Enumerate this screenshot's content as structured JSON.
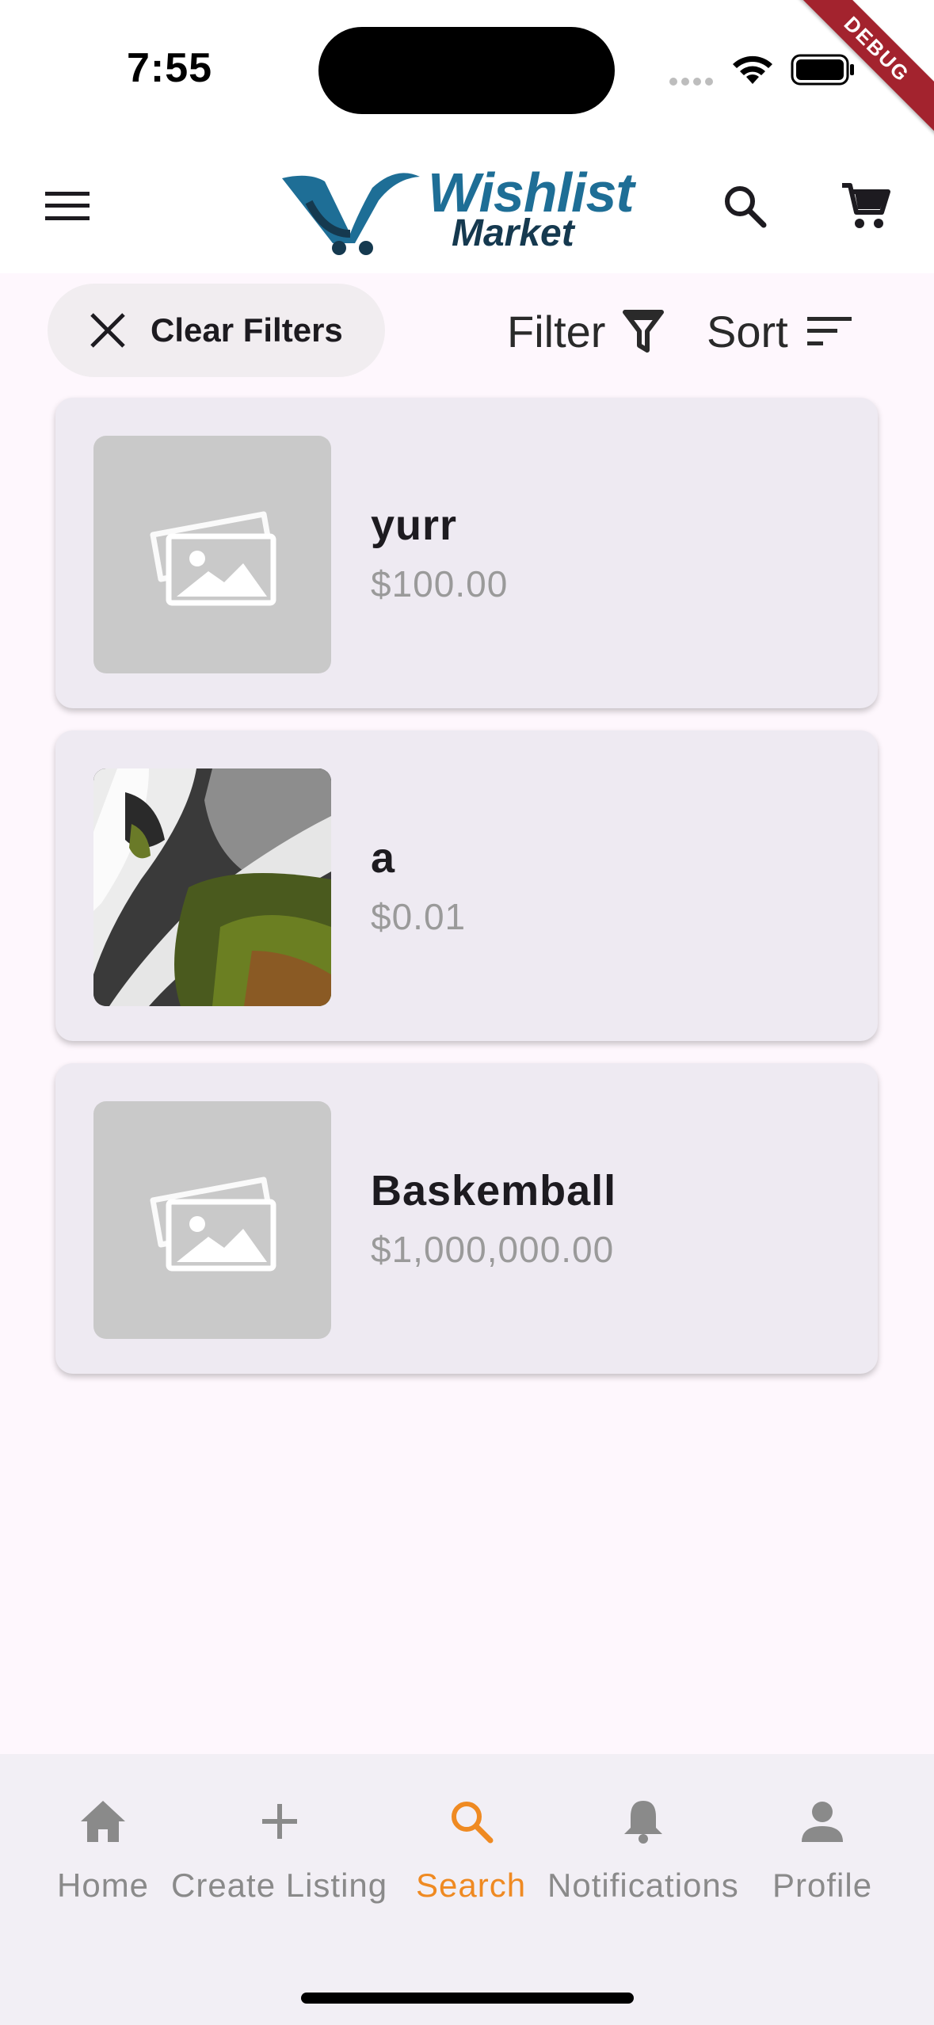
{
  "status_bar": {
    "time": "7:55"
  },
  "debug_label": "DEBUG",
  "app_bar": {
    "logo_title": "Wishlist",
    "logo_subtitle": "Market",
    "menu_icon": "hamburger-menu-icon",
    "search_icon": "search-icon",
    "cart_icon": "shopping-cart-icon"
  },
  "filters": {
    "clear_label": "Clear Filters",
    "filter_label": "Filter",
    "sort_label": "Sort"
  },
  "listings": [
    {
      "title": "yurr",
      "price": "$100.00",
      "image": "placeholder-image-icon"
    },
    {
      "title": "a",
      "price": "$0.01",
      "image": "waterfall-photo"
    },
    {
      "title": "Baskemball",
      "price": "$1,000,000.00",
      "image": "placeholder-image-icon"
    }
  ],
  "bottom_nav": {
    "items": [
      {
        "label": "Home",
        "icon": "home-icon"
      },
      {
        "label": "Create Listing",
        "icon": "plus-icon"
      },
      {
        "label": "Search",
        "icon": "search-icon",
        "active": true
      },
      {
        "label": "Notifications",
        "icon": "bell-icon"
      },
      {
        "label": "Profile",
        "icon": "person-icon"
      }
    ]
  },
  "colors": {
    "accent": "#ef8a22",
    "brand_primary": "#1e6e96",
    "brand_secondary": "#15394f",
    "inactive": "#8a8a8a",
    "card_bg": "#eeeaf2",
    "debug_ribbon": "#a3232e"
  }
}
